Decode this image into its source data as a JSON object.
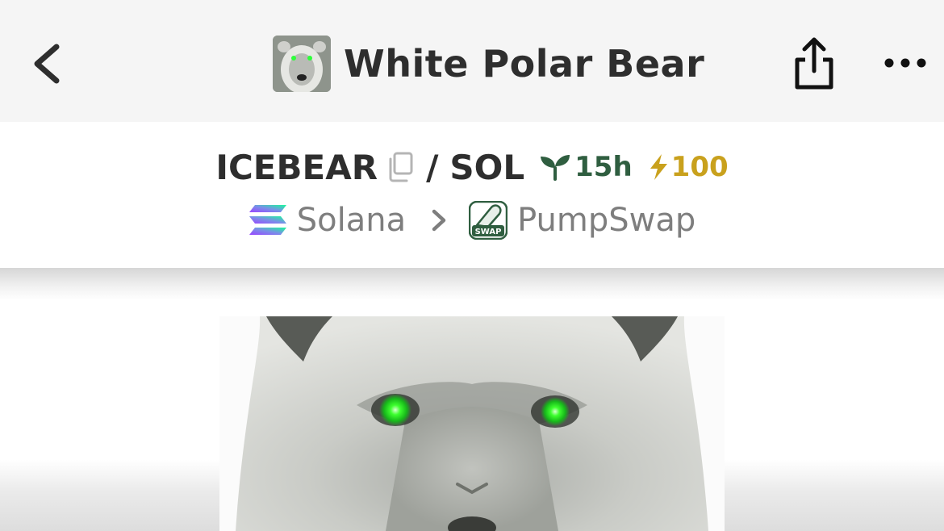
{
  "header": {
    "back_icon": "chevron-left-icon",
    "title": "White Polar Bear",
    "share_icon": "share-icon",
    "more_icon": "more-horizontal-icon"
  },
  "pair": {
    "base_symbol": "ICEBEAR",
    "separator": "/",
    "quote_symbol": "SOL",
    "age": "15h",
    "boosts": "100",
    "colors": {
      "age": "#2f5e40",
      "boost": "#c9a11d"
    }
  },
  "chain": {
    "name": "Solana",
    "dex": "PumpSwap",
    "dex_logo_text": "SWAP"
  }
}
